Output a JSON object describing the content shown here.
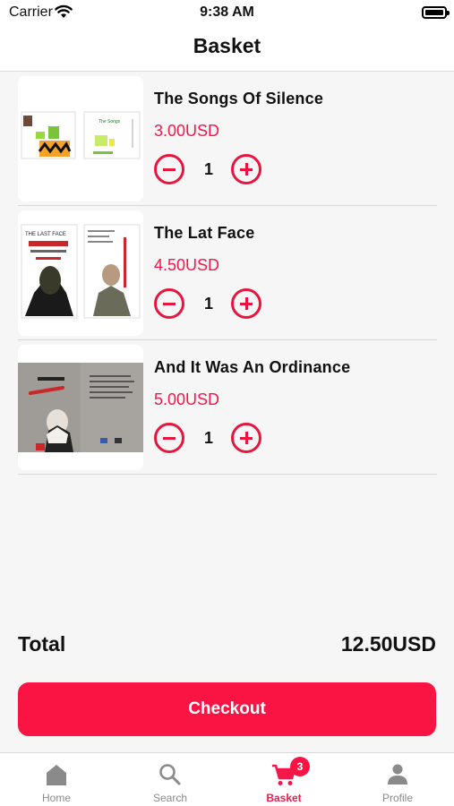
{
  "status_bar": {
    "carrier": "Carrier",
    "time": "9:38 AM",
    "wifi_icon": "wifi-icon",
    "battery_icon": "battery-icon"
  },
  "header": {
    "title": "Basket"
  },
  "basket": {
    "items": [
      {
        "title": "The Songs Of Silence",
        "price": "3.00USD",
        "quantity": "1",
        "cover": "book-cover-image"
      },
      {
        "title": "The Lat Face",
        "price": "4.50USD",
        "quantity": "1",
        "cover": "book-cover-image"
      },
      {
        "title": "And It Was An Ordinance",
        "price": "5.00USD",
        "quantity": "1",
        "cover": "book-cover-image"
      }
    ],
    "decrease_icon": "minus-circle-icon",
    "increase_icon": "plus-circle-icon"
  },
  "summary": {
    "total_label": "Total",
    "total_value": "12.50USD"
  },
  "checkout": {
    "label": "Checkout"
  },
  "tab_bar": {
    "tabs": [
      {
        "label": "Home",
        "icon": "home-icon",
        "active": false
      },
      {
        "label": "Search",
        "icon": "search-icon",
        "active": false
      },
      {
        "label": "Basket",
        "icon": "cart-icon",
        "active": true,
        "badge": "3"
      },
      {
        "label": "Profile",
        "icon": "person-icon",
        "active": false
      }
    ]
  },
  "colors": {
    "accent": "#fa1444",
    "price": "#f5174a",
    "inactive_tab": "#8a8a8a",
    "background": "#f6f6f6"
  }
}
